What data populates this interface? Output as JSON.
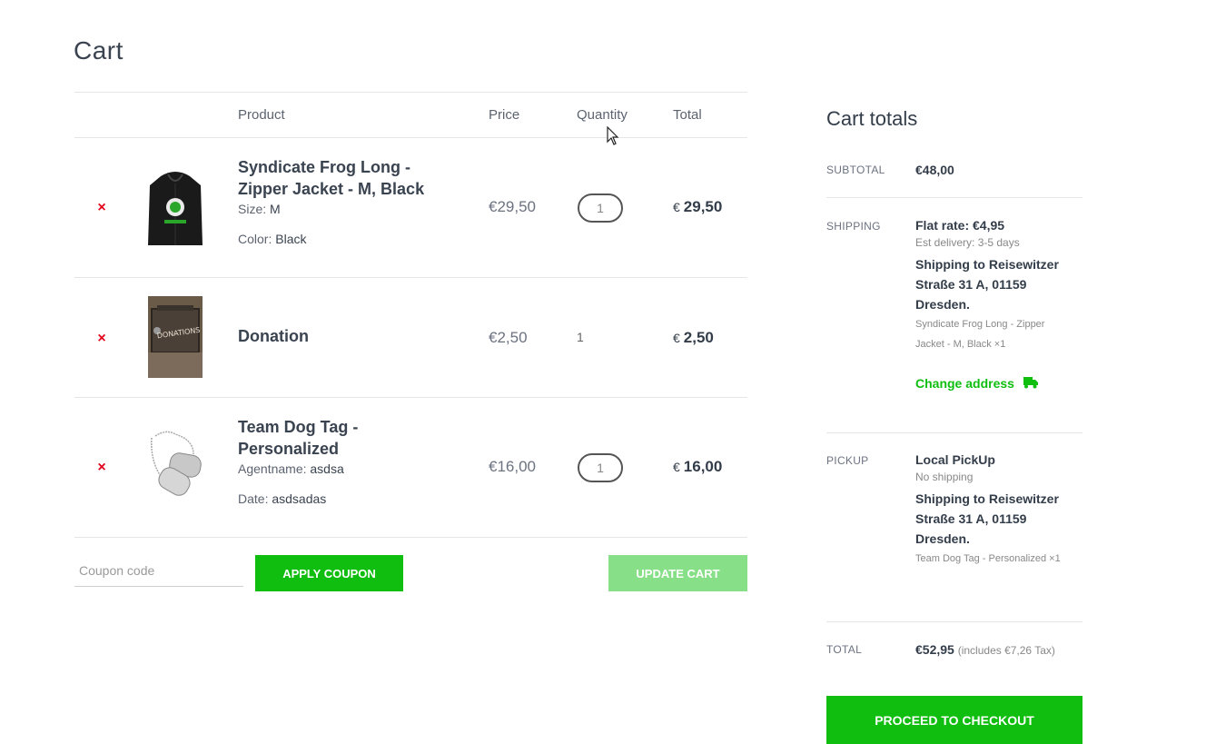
{
  "page": {
    "title": "Cart"
  },
  "table": {
    "headers": {
      "product": "Product",
      "price": "Price",
      "quantity": "Quantity",
      "total": "Total"
    },
    "items": [
      {
        "name_line1": "Syndicate Frog Long -",
        "name_line2": "Zipper Jacket - M, Black",
        "attr1_key": "Size:",
        "attr1_val": "M",
        "attr2_key": "Color:",
        "attr2_val": "Black",
        "price": "€29,50",
        "quantity": "1",
        "currency": "€",
        "total": "29,50",
        "remove": "×",
        "image": "hoodie-image"
      },
      {
        "name_line1": "Donation",
        "price": "€2,50",
        "quantity": "1",
        "currency": "€",
        "total": "2,50",
        "remove": "×",
        "image": "donation-box-image",
        "image_text": "DONATIONS"
      },
      {
        "name_line1": "Team Dog Tag -",
        "name_line2": "Personalized",
        "attr1_key": "Agentname:",
        "attr1_val": "asdsa",
        "attr2_key": "Date:",
        "attr2_val": "asdsadas",
        "price": "€16,00",
        "quantity": "1",
        "currency": "€",
        "total": "16,00",
        "remove": "×",
        "image": "dog-tag-image"
      }
    ]
  },
  "actions": {
    "coupon_placeholder": "Coupon code",
    "apply_coupon": "APPLY COUPON",
    "update_cart": "UPDATE CART"
  },
  "totals": {
    "title": "Cart totals",
    "subtotal_label": "SUBTOTAL",
    "subtotal_value": "€48,00",
    "shipping_label": "SHIPPING",
    "shipping_method": "Flat rate: €4,95",
    "shipping_eta": "Est delivery: 3-5 days",
    "shipping_addr1": "Shipping to Reisewitzer",
    "shipping_addr2": "Straße 31 A, 01159",
    "shipping_addr3": "Dresden.",
    "shipping_items1": "Syndicate Frog Long - Zipper",
    "shipping_items2": "Jacket - M, Black ×1",
    "change_address": "Change address",
    "pickup_label": "PICKUP",
    "pickup_method": "Local PickUp",
    "pickup_note": "No shipping",
    "pickup_addr1": "Shipping to Reisewitzer",
    "pickup_addr2": "Straße 31 A, 01159",
    "pickup_addr3": "Dresden.",
    "pickup_items": "Team Dog Tag - Personalized ×1",
    "total_label": "TOTAL",
    "total_value": "€52,95",
    "total_tax": "(includes €7,26 Tax)",
    "checkout": "PROCEED TO CHECKOUT"
  },
  "colors": {
    "accent": "#0fbe0f",
    "accent_disabled": "#87df87",
    "remove": "#e2001a",
    "text": "#333d4a"
  }
}
